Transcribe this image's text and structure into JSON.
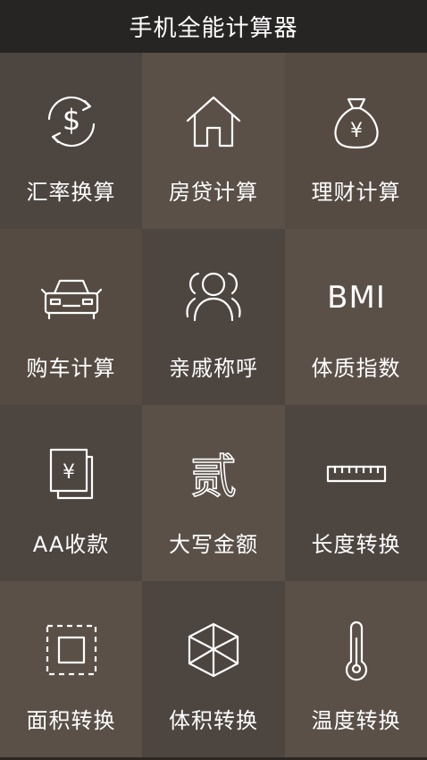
{
  "app": {
    "title": "手机全能计算器"
  },
  "colors": {
    "titlebar_bg": "#262524",
    "tile_dark": "#4d4540",
    "tile_light": "#5a5048",
    "tile_mid": "#554b43",
    "icon_stroke": "#ffffff",
    "label_text": "#ffffff"
  },
  "tiles": [
    {
      "label": "汇率换算",
      "icon": "currency-exchange-icon",
      "shade": "dark"
    },
    {
      "label": "房贷计算",
      "icon": "house-icon",
      "shade": "light"
    },
    {
      "label": "理财计算",
      "icon": "money-bag-icon",
      "shade": "mid"
    },
    {
      "label": "购车计算",
      "icon": "car-icon",
      "shade": "mid"
    },
    {
      "label": "亲戚称呼",
      "icon": "people-icon",
      "shade": "dark"
    },
    {
      "label": "体质指数",
      "icon": "bmi-icon",
      "icon_text": "BMI",
      "shade": "light"
    },
    {
      "label": "AA收款",
      "icon": "yen-cards-icon",
      "shade": "dark"
    },
    {
      "label": "大写金额",
      "icon": "chinese-numeral-icon",
      "icon_text": "贰",
      "shade": "light"
    },
    {
      "label": "长度转换",
      "icon": "ruler-icon",
      "shade": "dark"
    },
    {
      "label": "面积转换",
      "icon": "area-square-icon",
      "shade": "light"
    },
    {
      "label": "体积转换",
      "icon": "cube-icon",
      "shade": "dark"
    },
    {
      "label": "温度转换",
      "icon": "thermometer-icon",
      "shade": "light"
    }
  ]
}
